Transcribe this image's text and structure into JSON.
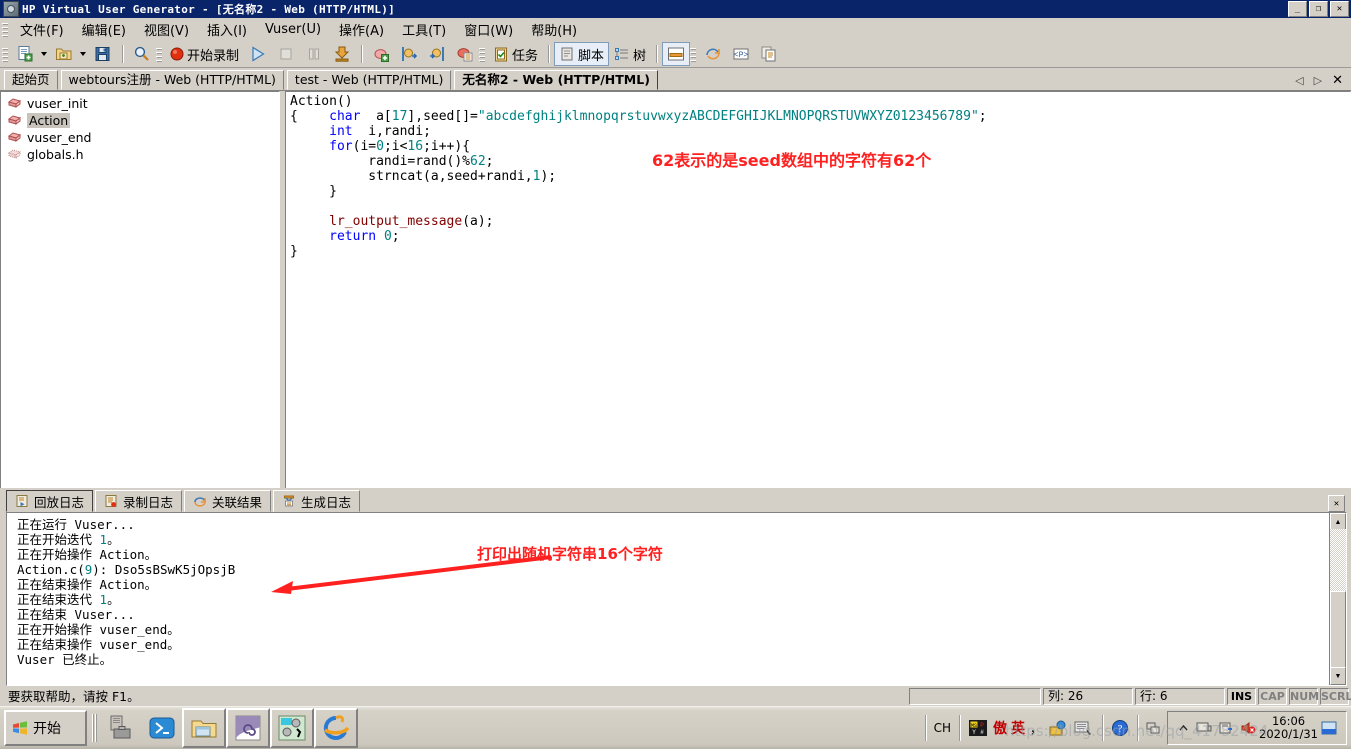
{
  "window": {
    "title": "HP Virtual User Generator - [无名称2 - Web (HTTP/HTML)]",
    "icon": "app-icon",
    "minimize": "_",
    "maximize": "❐",
    "close": "✕"
  },
  "menubar": {
    "items": [
      {
        "label": "文件(F)",
        "name": "menu-file"
      },
      {
        "label": "编辑(E)",
        "name": "menu-edit"
      },
      {
        "label": "视图(V)",
        "name": "menu-view"
      },
      {
        "label": "插入(I)",
        "name": "menu-insert"
      },
      {
        "label": "Vuser(U)",
        "name": "menu-vuser"
      },
      {
        "label": "操作(A)",
        "name": "menu-action"
      },
      {
        "label": "工具(T)",
        "name": "menu-tools"
      },
      {
        "label": "窗口(W)",
        "name": "menu-window"
      },
      {
        "label": "帮助(H)",
        "name": "menu-help"
      }
    ]
  },
  "toolbar": {
    "record_label": "开始录制",
    "task_label": "任务",
    "script_label": "脚本",
    "tree_label": "树"
  },
  "tabs": {
    "items": [
      {
        "label": "起始页",
        "active": false
      },
      {
        "label": "webtours注册 - Web (HTTP/HTML)",
        "active": false
      },
      {
        "label": "test - Web (HTTP/HTML)",
        "active": false
      },
      {
        "label": "无名称2 - Web (HTTP/HTML)",
        "active": true
      }
    ],
    "prev": "◁",
    "next": "▷",
    "close": "✕"
  },
  "tree": {
    "items": [
      {
        "label": "vuser_init",
        "selected": false,
        "icon": "action-block-icon"
      },
      {
        "label": "Action",
        "selected": true,
        "icon": "action-block-icon"
      },
      {
        "label": "vuser_end",
        "selected": false,
        "icon": "action-block-icon"
      },
      {
        "label": "globals.h",
        "selected": false,
        "icon": "header-file-icon"
      }
    ]
  },
  "editor": {
    "lines": [
      "Action()",
      "{    char  a[17],seed[]=\"abcdefghijklmnopqrstuvwxyzABCDEFGHIJKLMNOPQRSTUVWXYZ0123456789\";",
      "     int  i,randi;",
      "     for(i=0;i<16;i++){",
      "          randi=rand()%62;",
      "          strncat(a,seed+randi,1);",
      "     }",
      "",
      "     lr_output_message(a);",
      "     return 0;",
      "}"
    ],
    "seed_string": "abcdefghijklmnopqrstuvwxyzABCDEFGHIJKLMNOPQRSTUVWXYZ0123456789",
    "annotation": "62表示的是seed数组中的字符有62个",
    "annotation_color": "#ff2020"
  },
  "logpanel": {
    "tabs": [
      {
        "label": "回放日志",
        "active": true,
        "icon": "replay-log-icon"
      },
      {
        "label": "录制日志",
        "active": false,
        "icon": "record-log-icon"
      },
      {
        "label": "关联结果",
        "active": false,
        "icon": "correlation-icon"
      },
      {
        "label": "生成日志",
        "active": false,
        "icon": "generation-log-icon"
      }
    ],
    "close": "✕",
    "lines": [
      "正在运行 Vuser...",
      "正在开始迭代 1。",
      "正在开始操作 Action。",
      "Action.c(9): Dso5sBSwK5jOpsjB",
      "正在结束操作 Action。",
      "正在结束迭代 1。",
      "正在结束 Vuser...",
      "正在开始操作 vuser_end。",
      "正在结束操作 vuser_end。",
      "Vuser 已终止。"
    ],
    "output_string": "Dso5sBSwK5jOpsjB",
    "annotation": "打印出随机字符串16个字符",
    "annotation_color": "#ff2020"
  },
  "statusbar": {
    "message": "要获取帮助，请按 F1。",
    "blank": "",
    "column": "列: 26",
    "row": "行: 6",
    "ins": "INS",
    "cap": "CAP",
    "num": "NUM",
    "scrl": "SCRL"
  },
  "taskbar": {
    "start": "开始",
    "tray": {
      "lang": "CH",
      "ime_label": "英",
      "punct": "，",
      "time": "16:06",
      "date": "2020/1/31"
    },
    "watermark": "https://blog.csdn.net/qq_41782424"
  }
}
